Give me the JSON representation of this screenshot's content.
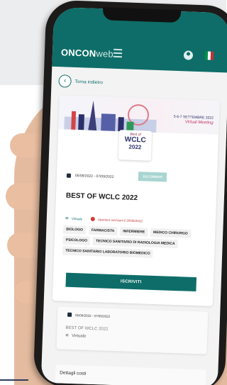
{
  "app": {
    "logo_onc": "ONC",
    "logo_on": "ON",
    "logo_web": "web",
    "menu_icon": "hamburger-icon",
    "user_icon": "user-icon",
    "flag_icon": "italy-flag-icon",
    "flag_colors": [
      "#009246",
      "#ffffff",
      "#ce2b37"
    ],
    "accent_color": "#0e6d68"
  },
  "nav": {
    "back_label": "Torna indietro"
  },
  "event": {
    "banner_dates": "5-6-7 SETTEMBRE 2022",
    "banner_virtual": "Virtual Meeting",
    "logo_line1": "Best of",
    "logo_line2": "WCLC",
    "logo_line3": "2022",
    "date_range": "05/09/2022 - 07/09/2022",
    "credits": "10,5 CREDITI",
    "title": "BEST OF WCLC 2022",
    "mode": "Virtuale",
    "open_status": "Aperture iscrizioni il 20/06/2022",
    "tags": [
      "BIOLOGO",
      "FARMACISTA",
      "INFERMIERE",
      "MEDICO CHIRURGO",
      "PSICOLOGO",
      "TECNICO SANITARIO DI RADIOLOGIA MEDICA",
      "TECNICO SANITARIO LABORATORIO BIOMEDICO"
    ],
    "enroll_label": "ISCRIVITI"
  },
  "summary": {
    "date_range": "05/09/2022 - 07/09/2022",
    "title": "BEST OF WCLC 2022",
    "mode": "Virtuale"
  },
  "costs": {
    "label": "Dettagli costi"
  }
}
